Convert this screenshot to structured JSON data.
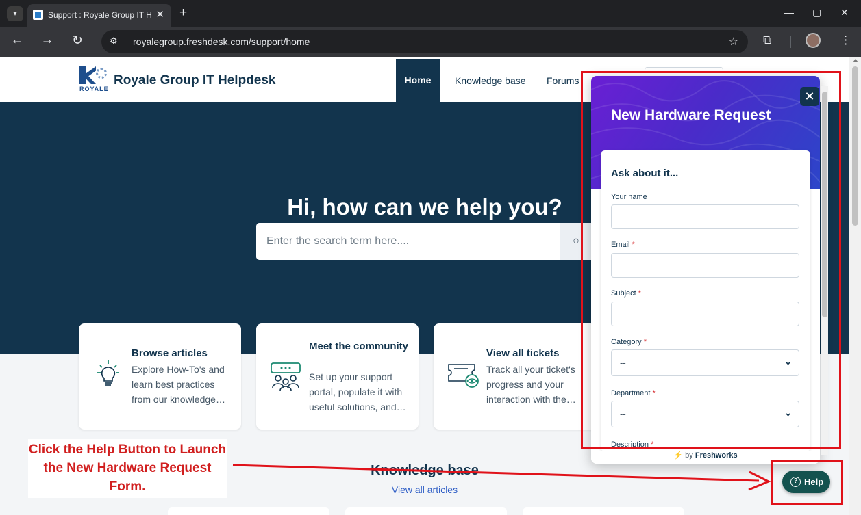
{
  "browser": {
    "tab_title": "Support : Royale Group IT Helpdesk",
    "url": "royalegroup.freshdesk.com/support/home"
  },
  "portal": {
    "logo_text": "ROYALE",
    "brand": "Royale Group IT Helpdesk",
    "nav": {
      "home": "Home",
      "knowledge_base": "Knowledge base",
      "forums": "Forums"
    },
    "hero_title": "Hi, how can we help you?",
    "search_placeholder": "Enter the search term here....",
    "cards": [
      {
        "title": "Browse articles",
        "desc": "Explore How-To's and learn best practices from our knowledge…",
        "icon": "lightbulb-icon"
      },
      {
        "title": "Meet the community",
        "desc": "Set up your support portal, populate it with useful solutions, and…",
        "icon": "community-icon"
      },
      {
        "title": "View all tickets",
        "desc": "Track all your ticket's progress and your interaction with the…",
        "icon": "tickets-icon"
      }
    ],
    "kb_title": "Knowledge base",
    "kb_link": "View all articles"
  },
  "widget": {
    "title": "New Hardware Request",
    "form_heading": "Ask about it...",
    "fields": {
      "name": "Your name",
      "email": "Email",
      "subject": "Subject",
      "category": "Category",
      "department": "Department",
      "description": "Description"
    },
    "required_mark": "*",
    "select_placeholder": "--",
    "powered_prefix": "by",
    "powered_brand": "Freshworks",
    "help_label": "Help"
  },
  "annotation": {
    "callout": "Click the Help Button to Launch the New Hardware Request Form."
  },
  "colors": {
    "brand_navy": "#12344d",
    "help_green": "#14524f",
    "annotation_red": "#e0121a"
  }
}
